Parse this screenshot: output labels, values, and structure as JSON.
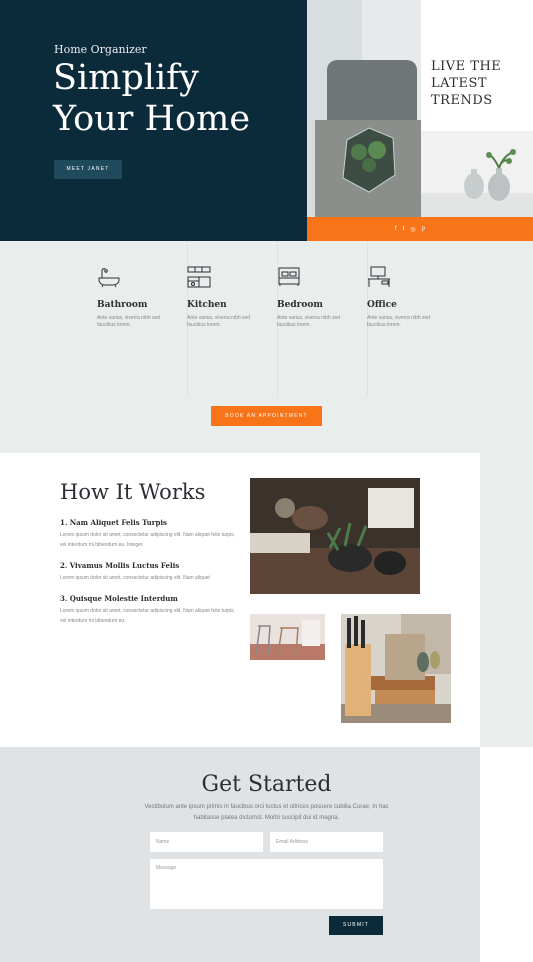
{
  "hero": {
    "eyebrow": "Home Organizer",
    "title_line1": "Simplify",
    "title_line2": "Your Home",
    "button_label": "MEET JANET",
    "trends_line1": "LIVE THE",
    "trends_line2": "LATEST",
    "trends_line3": "TRENDS",
    "social_icons": [
      "facebook-icon",
      "twitter-icon",
      "instagram-icon",
      "pinterest-icon"
    ],
    "social_glyphs": [
      "f",
      "t",
      "◎",
      "p"
    ]
  },
  "rooms": {
    "items": [
      {
        "name": "Bathroom",
        "desc": "Ante varius, viverra nibh sed faucibus lorem.",
        "icon": "bathtub-icon"
      },
      {
        "name": "Kitchen",
        "desc": "Ante varius, viverra nibh sed faucibus lorem.",
        "icon": "kitchen-icon"
      },
      {
        "name": "Bedroom",
        "desc": "Ante varius, viverra nibh sed faucibus lorem.",
        "icon": "bed-icon"
      },
      {
        "name": "Office",
        "desc": "Ante varius, viverra nibh sed faucibus lorem.",
        "icon": "desk-icon"
      }
    ],
    "button_label": "BOOK AN APPOINTMENT"
  },
  "how": {
    "title": "How It Works",
    "steps": [
      {
        "heading": "1. Nam Aliquet Felis Turpis",
        "text": "Lorem ipsum dolor sit amet, consectetur adipiscing elit. Nam aliquet felis turpis, vel interdum mi bibendum eu. Integer."
      },
      {
        "heading": "2. Vivamus Mollis Luctus Felis",
        "text": "Lorem ipsum dolor sit amet, consectetur adipiscing elit. Nam aliquet"
      },
      {
        "heading": "3. Quisque Molestie Interdum",
        "text": "Lorem ipsum dolor sit amet, consectetur adipiscing elit. Nam aliquet felis turpis, vel interdum mi bibendum eu."
      }
    ]
  },
  "get_started": {
    "title": "Get Started",
    "desc": "Vestibulum ante ipsum primis in faucibus orci luctus et ultrices posuere cubilia Curae; In hac habitasse platea dictumst. Morbi suscipit dui id magna.",
    "name_placeholder": "Name",
    "email_placeholder": "Email Address",
    "message_placeholder": "Message",
    "submit_label": "SUBMIT"
  },
  "colors": {
    "navy": "#0c2b3a",
    "orange": "#f77418",
    "light_bg": "#e9eeec"
  }
}
